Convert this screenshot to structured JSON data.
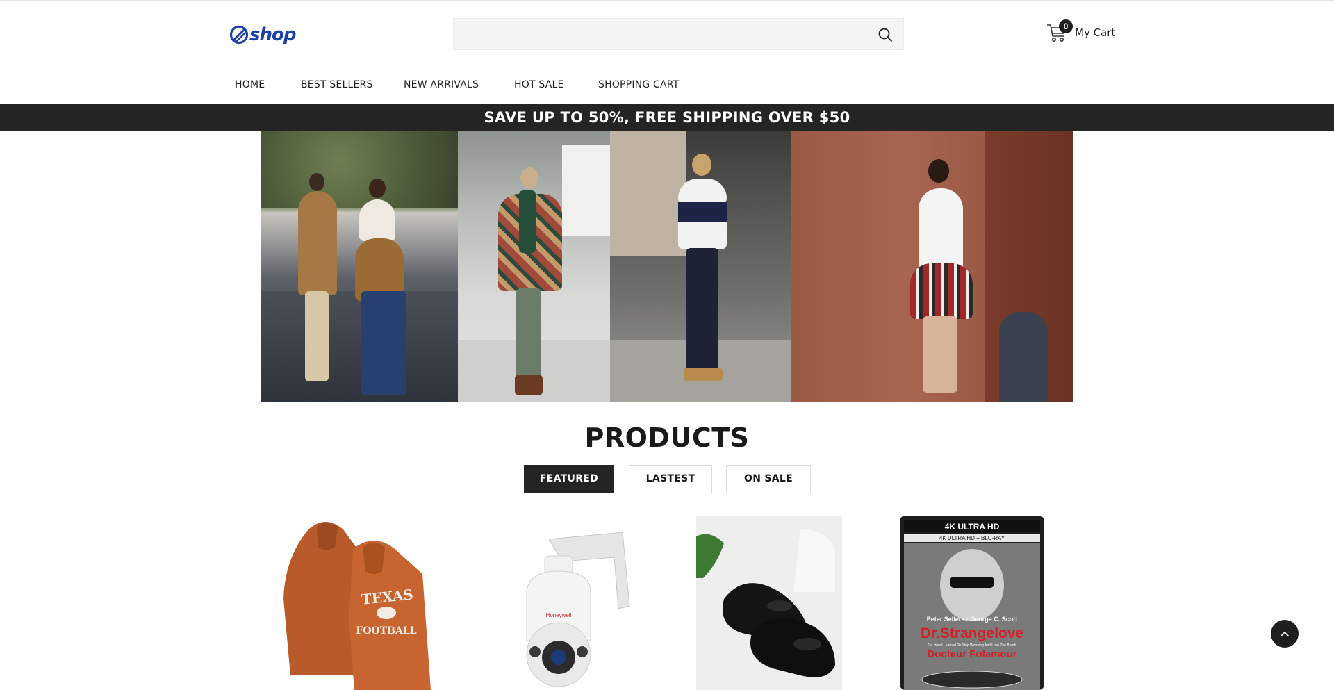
{
  "header": {
    "logo_text": "shop",
    "search_placeholder": "",
    "cart_count": "0",
    "cart_label": "My Cart"
  },
  "nav": {
    "items": [
      {
        "label": "HOME"
      },
      {
        "label": "BEST SELLERS"
      },
      {
        "label": "NEW ARRIVALS"
      },
      {
        "label": "HOT SALE"
      },
      {
        "label": "SHOPPING CART"
      }
    ]
  },
  "promo": {
    "text": "SAVE UP TO 50%, FREE SHIPPING OVER $50"
  },
  "products": {
    "title": "PRODUCTS",
    "tabs": [
      {
        "label": "FEATURED",
        "active": true
      },
      {
        "label": "LASTEST",
        "active": false
      },
      {
        "label": "ON SALE",
        "active": false
      }
    ],
    "items": [
      {
        "image": "orange-texas-football-hoodies"
      },
      {
        "image": "honeywell-ptz-security-camera",
        "brand_text": "Honeywell"
      },
      {
        "image": "black-wedge-pumps"
      },
      {
        "image": "dr-strangelove-4k-bluray",
        "cover_top": "4K ULTRA HD",
        "cover_sub": "4K ULTRA HD + BLU-RAY",
        "cover_credit": "Peter Sellers · George C. Scott",
        "cover_title": "Dr.Strangelove",
        "cover_tagline": "Or: How I Learned To Stop Worrying And Love The Bomb",
        "cover_alt_title": "Docteur Folamour"
      }
    ]
  },
  "colors": {
    "brand": "#1c3fa8",
    "dark": "#242424",
    "hoodie": "#c8642f"
  }
}
